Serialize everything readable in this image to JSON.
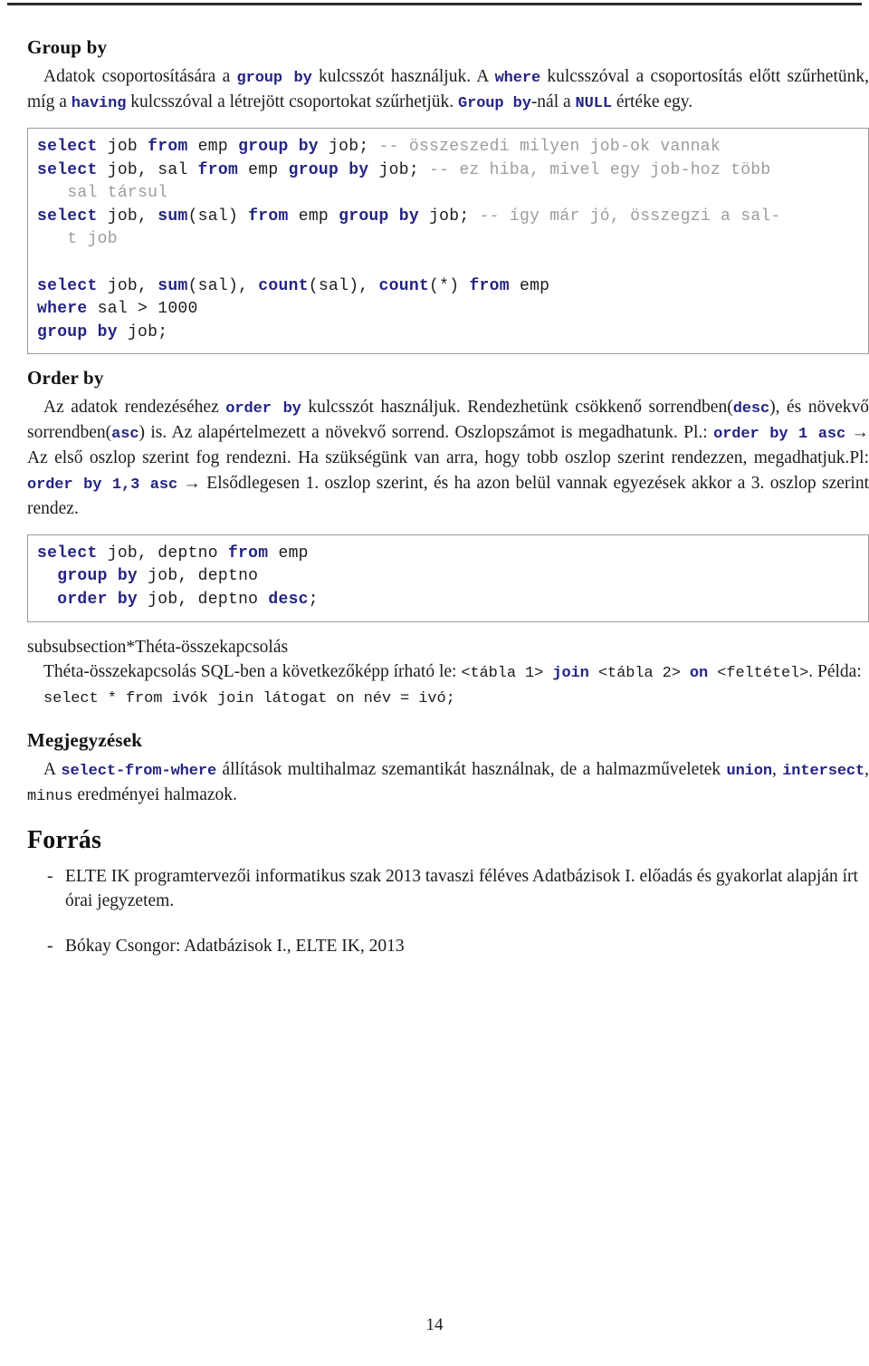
{
  "document": {
    "page_number": "14"
  },
  "group_by": {
    "heading": "Group by",
    "paragraph": {
      "p1": "Adatok csoportosítására a ",
      "kw1": "group by",
      "p2": " kulcsszót használjuk.  A ",
      "kw2": "where",
      "p3": " kulcsszóval a csoportosítás előtt szűrhetünk, míg a ",
      "kw3": "having",
      "p4": " kulcsszóval a létrejött csoportokat szűrhetjük. ",
      "kw4": "Group by",
      "p5": "-nál a ",
      "kw5": "NULL",
      "p6": " értéke egy."
    },
    "code_block_1": [
      {
        "t": "k",
        "v": "select"
      },
      {
        "t": "n",
        "v": " job "
      },
      {
        "t": "k",
        "v": "from"
      },
      {
        "t": "n",
        "v": " emp "
      },
      {
        "t": "k",
        "v": "group by"
      },
      {
        "t": "n",
        "v": " job; "
      },
      {
        "t": "c",
        "v": "-- összeszedi milyen job-ok vannak"
      },
      {
        "t": "n",
        "v": "\n"
      },
      {
        "t": "k",
        "v": "select"
      },
      {
        "t": "n",
        "v": " job, sal "
      },
      {
        "t": "k",
        "v": "from"
      },
      {
        "t": "n",
        "v": " emp "
      },
      {
        "t": "k",
        "v": "group by"
      },
      {
        "t": "n",
        "v": " job; "
      },
      {
        "t": "c",
        "v": "-- ez hiba, mivel egy job-hoz több\n   sal társul"
      },
      {
        "t": "n",
        "v": "\n"
      },
      {
        "t": "k",
        "v": "select"
      },
      {
        "t": "n",
        "v": " job, "
      },
      {
        "t": "k",
        "v": "sum"
      },
      {
        "t": "n",
        "v": "(sal) "
      },
      {
        "t": "k",
        "v": "from"
      },
      {
        "t": "n",
        "v": " emp "
      },
      {
        "t": "k",
        "v": "group by"
      },
      {
        "t": "n",
        "v": " job; "
      },
      {
        "t": "c",
        "v": "-- így már jó, összegzi a sal-\n   t job"
      },
      {
        "t": "n",
        "v": "\n\n"
      },
      {
        "t": "k",
        "v": "select"
      },
      {
        "t": "n",
        "v": " job, "
      },
      {
        "t": "k",
        "v": "sum"
      },
      {
        "t": "n",
        "v": "(sal), "
      },
      {
        "t": "k",
        "v": "count"
      },
      {
        "t": "n",
        "v": "(sal), "
      },
      {
        "t": "k",
        "v": "count"
      },
      {
        "t": "n",
        "v": "(*) "
      },
      {
        "t": "k",
        "v": "from"
      },
      {
        "t": "n",
        "v": " emp\n"
      },
      {
        "t": "k",
        "v": "where"
      },
      {
        "t": "n",
        "v": " sal > 1000\n"
      },
      {
        "t": "k",
        "v": "group by"
      },
      {
        "t": "n",
        "v": " job;"
      }
    ]
  },
  "order_by": {
    "heading": "Order by",
    "paragraph": {
      "p1": "Az adatok rendezéséhez ",
      "kw1": "order by",
      "p2": " kulcsszót használjuk.  Rendezhetünk csökkenő sorrendben(",
      "kw2": "desc",
      "p3": "), és növekvő sorrendben(",
      "kw3": "asc",
      "p4": ") is.  Az alapértelmezett a növekvő sorrend. Oszlopszámot is megadhatunk.  Pl.: ",
      "kw4": "order by 1 asc",
      "p5": " → Az első oszlop szerint fog rendezni. Ha szükségünk van arra, hogy tobb oszlop szerint rendezzen, megadhatjuk.Pl: ",
      "kw5": "order by 1,3 asc",
      "p6": " → Elsődlegesen 1.  oszlop szerint, és ha azon belül vannak egyezések akkor a 3.  oszlop szerint rendez."
    },
    "code_block_2": [
      {
        "t": "k",
        "v": "select"
      },
      {
        "t": "n",
        "v": " job, deptno "
      },
      {
        "t": "k",
        "v": "from"
      },
      {
        "t": "n",
        "v": " emp\n  "
      },
      {
        "t": "k",
        "v": "group by"
      },
      {
        "t": "n",
        "v": " job, deptno\n  "
      },
      {
        "t": "k",
        "v": "order by"
      },
      {
        "t": "n",
        "v": " job, deptno "
      },
      {
        "t": "k",
        "v": "desc"
      },
      {
        "t": "n",
        "v": ";"
      }
    ]
  },
  "theta": {
    "heading": "subsubsection*Théta-összekapcsolás",
    "paragraph": {
      "p1": "Théta-összekapcsolás SQL-ben a következőképp írható le: ",
      "lit1": "<tábla 1> ",
      "kw1": "join",
      "lit2": " <tábla 2> ",
      "kw2": "on",
      "lit3": " <feltétel>",
      "p2": ". Példa:"
    },
    "example": [
      {
        "t": "k",
        "v": "select"
      },
      {
        "t": "n",
        "v": " * "
      },
      {
        "t": "k",
        "v": "from"
      },
      {
        "t": "n",
        "v": " ivók "
      },
      {
        "t": "k",
        "v": "join"
      },
      {
        "t": "n",
        "v": " látogat "
      },
      {
        "t": "k",
        "v": "on"
      },
      {
        "t": "n",
        "v": " név = ivó;"
      }
    ]
  },
  "notes": {
    "heading": "Megjegyzések",
    "paragraph": {
      "p1": "A ",
      "kw1": "select-from-where",
      "p2": " állítások multihalmaz szemantikát használnak, de a halmazműveletek ",
      "kw2": "union",
      "p3": ", ",
      "kw3": "intersect",
      "p4": ", ",
      "lit1": "minus",
      "p5": " eredményei halmazok."
    }
  },
  "sources": {
    "heading": "Forrás",
    "dash": "-",
    "items": [
      "ELTE IK programtervezői informatikus szak 2013 tavaszi féléves Adatbázisok I. előadás és gyakorlat alapján írt órai jegyzetem.",
      "Bókay Csongor: Adatbázisok I., ELTE IK, 2013"
    ]
  },
  "colors": {
    "keyword_blue": "#242484",
    "comment_gray": "#9c9c9c",
    "text_black": "#1c1c1c",
    "code_border": "#9a9a9a",
    "rule": "#2b2b2b"
  }
}
